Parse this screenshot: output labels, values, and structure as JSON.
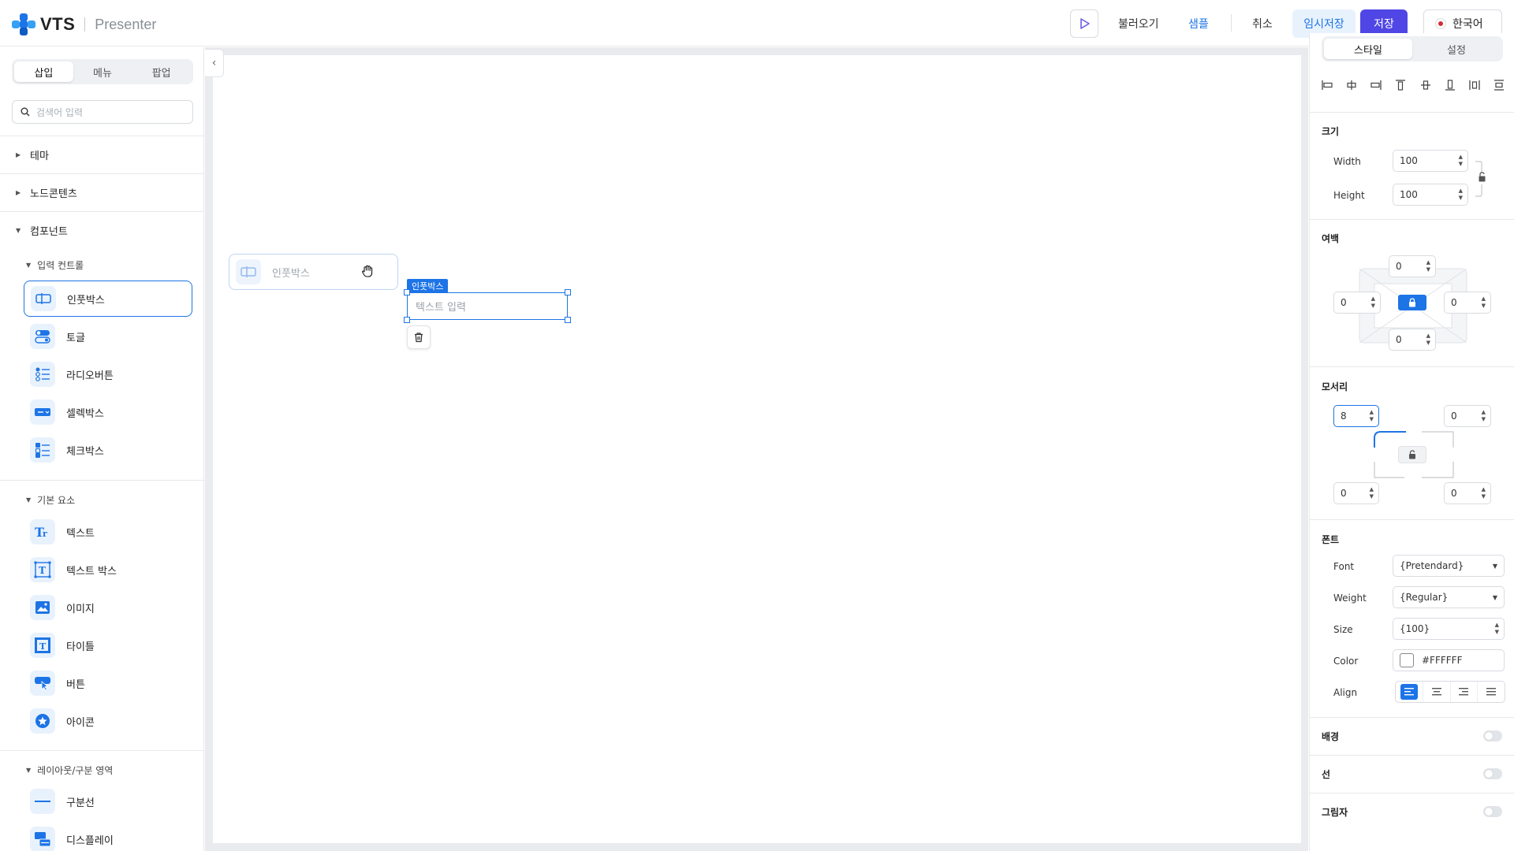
{
  "header": {
    "brand": "VTS",
    "product": "Presenter",
    "load_label": "불러오기",
    "sample_label": "샘플",
    "cancel_label": "취소",
    "temp_save_label": "임시저장",
    "save_label": "저장",
    "language_label": "한국어"
  },
  "left_panel": {
    "tabs": [
      "삽입",
      "메뉴",
      "팝업"
    ],
    "active_tab": "삽입",
    "search_placeholder": "검색어 입력",
    "sections": {
      "theme": "테마",
      "node_contents": "노드콘텐츠",
      "components": "컴포넌트"
    },
    "groups": {
      "input_controls": "입력 컨트롤",
      "basic_elements": "기본 요소",
      "layout": "레이아웃/구분 영역"
    },
    "input_items": [
      "인풋박스",
      "토글",
      "라디오버튼",
      "셀렉박스",
      "체크박스"
    ],
    "basic_items": [
      "텍스트",
      "텍스트 박스",
      "이미지",
      "타이틀",
      "버튼",
      "아이콘"
    ],
    "layout_items": [
      "구분선",
      "디스플레이"
    ],
    "selected_item": "인풋박스"
  },
  "canvas": {
    "drag_ghost_label": "인풋박스",
    "selected_label": "인풋박스",
    "input_placeholder": "텍스트 입력"
  },
  "right_panel": {
    "tabs": [
      "스타일",
      "설정"
    ],
    "active_tab": "스타일",
    "size": {
      "title": "크기",
      "width_label": "Width",
      "width": "100",
      "height_label": "Height",
      "height": "100"
    },
    "margin": {
      "title": "여백",
      "top": "0",
      "left": "0",
      "right": "0",
      "bottom": "0"
    },
    "corner": {
      "title": "모서리",
      "top_left": "8",
      "top_right": "0",
      "bottom_left": "0",
      "bottom_right": "0"
    },
    "font": {
      "title": "폰트",
      "font_label": "Font",
      "font": "{Pretendard}",
      "weight_label": "Weight",
      "weight": "{Regular}",
      "size_label": "Size",
      "size": "{100}",
      "color_label": "Color",
      "color": "#FFFFFF",
      "align_label": "Align"
    },
    "background_label": "배경",
    "line_label": "선",
    "shadow_label": "그림자"
  },
  "colors": {
    "accent": "#1d74e6",
    "save": "#4f46e5"
  }
}
